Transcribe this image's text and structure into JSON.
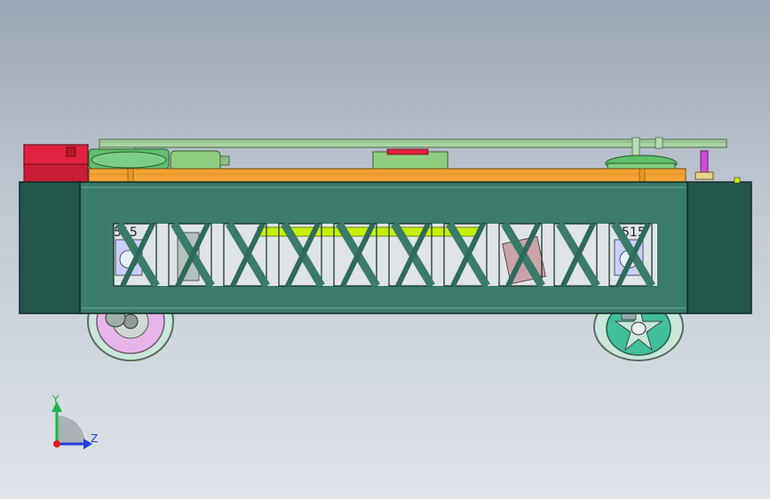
{
  "model": {
    "part_markings": [
      "515",
      "515"
    ],
    "colors": {
      "chassis": "#3a7b69",
      "chassis_dark": "#24564a",
      "deck": "#f2a233",
      "rail": "#a9d3a2",
      "motor_box": "#e0223f",
      "wheel": "#c8e7d8",
      "spring_bar": "#c6f000"
    }
  },
  "triad": {
    "y_label": "Y",
    "z_label": "Z",
    "colors": {
      "y": "#22b24c",
      "z": "#1f3fe0",
      "origin": "#e11b1b"
    }
  }
}
